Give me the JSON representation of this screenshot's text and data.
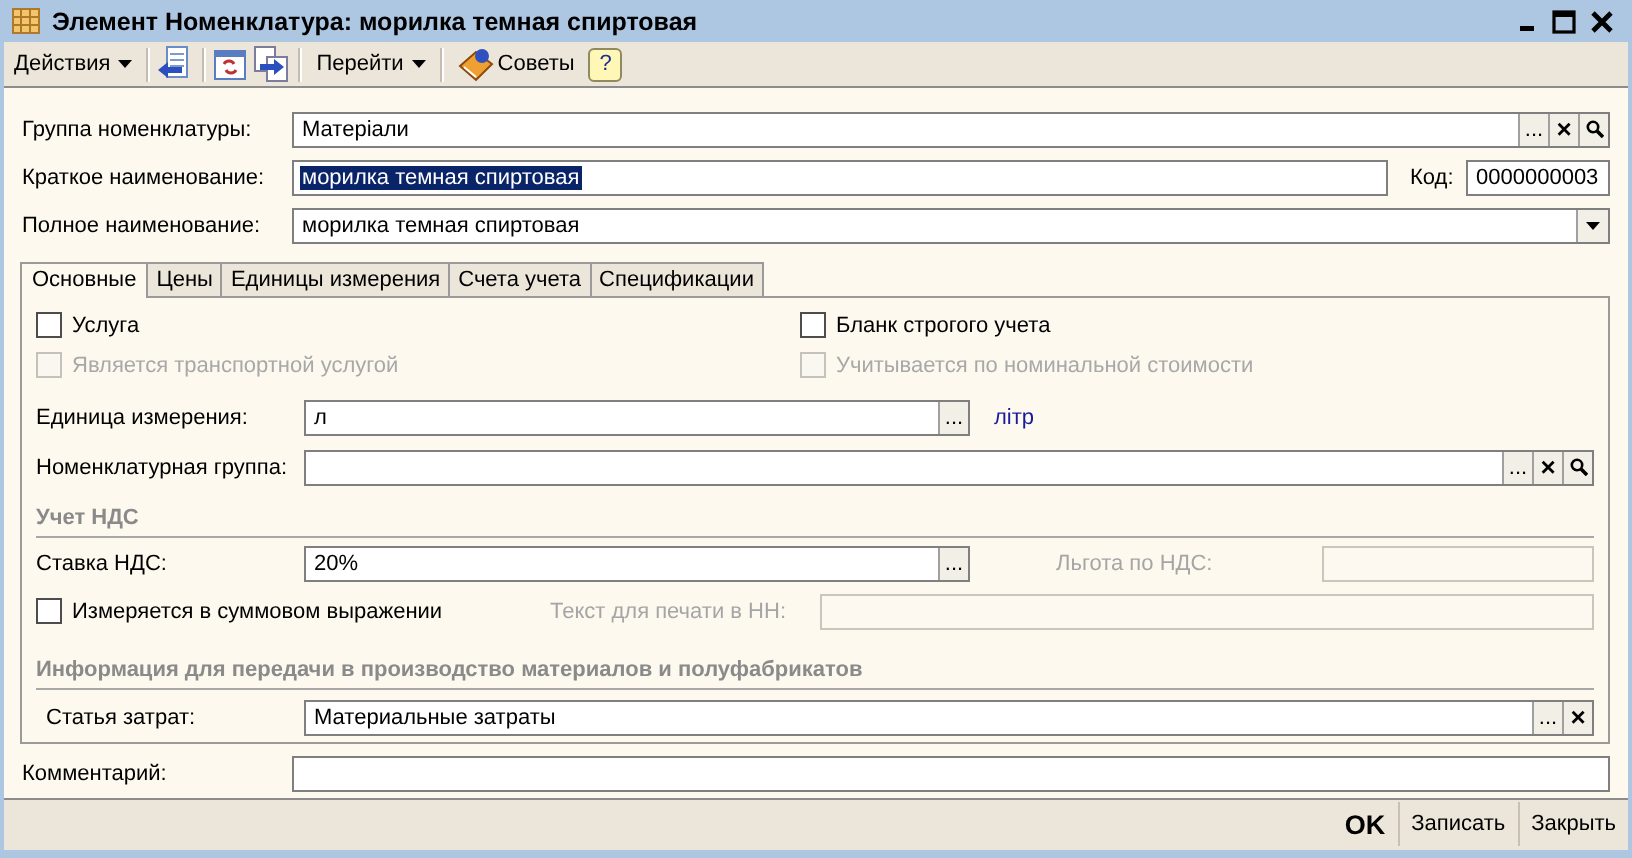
{
  "window": {
    "title": "Элемент Номенклатура: морилка темная спиртовая"
  },
  "toolbar": {
    "actions_menu": "Действия",
    "goto_menu": "Перейти",
    "tips_button": "Советы",
    "help_button": "?"
  },
  "group": {
    "label": "Группа номенклатуры:",
    "value": "Матеріали",
    "buttons": [
      {
        "kind": "select",
        "label": "..."
      },
      {
        "kind": "clear",
        "label": "×"
      },
      {
        "kind": "search"
      }
    ]
  },
  "short_name": {
    "label": "Краткое наименование:",
    "value": "морилка темная спиртовая",
    "selected": true
  },
  "code": {
    "label": "Код:",
    "value": "0000000003"
  },
  "full_name": {
    "label": "Полное наименование:",
    "value": "морилка темная спиртовая",
    "buttons": [
      {
        "kind": "dropdown"
      }
    ]
  },
  "tabs": [
    {
      "label": "Основные",
      "selected": true
    },
    {
      "label": "Цены",
      "selected": false
    },
    {
      "label": "Единицы измерения",
      "selected": false
    },
    {
      "label": "Счета учета",
      "selected": false
    },
    {
      "label": "Спецификации",
      "selected": false
    }
  ],
  "checkboxes": [
    {
      "label": "Услуга",
      "checked": false,
      "disabled": false
    },
    {
      "label": "Бланк строгого учета",
      "checked": false,
      "disabled": false
    },
    {
      "label": "Является транспортной услугой",
      "checked": false,
      "disabled": true
    },
    {
      "label": "Учитывается по номинальной стоимости",
      "checked": false,
      "disabled": true
    }
  ],
  "unit": {
    "label": "Единица измерения:",
    "value": "л",
    "buttons": [
      {
        "kind": "select",
        "label": "..."
      }
    ],
    "link": "літр"
  },
  "item_group": {
    "label": "Номенклатурная группа:",
    "buttons": [
      {
        "kind": "select",
        "label": "..."
      },
      {
        "kind": "clear",
        "label": "×"
      },
      {
        "kind": "search"
      }
    ]
  },
  "vat_section": {
    "title": "Учет НДС"
  },
  "vat_rate": {
    "label": "Ставка НДС:",
    "value": "20%",
    "buttons": [
      {
        "kind": "select",
        "label": "..."
      }
    ]
  },
  "vat_benefit": {
    "label": "Льгота по НДС:",
    "disabled": true
  },
  "sum_checkbox": {
    "label": "Измеряется в суммовом выражении",
    "checked": false,
    "disabled": false
  },
  "print_text": {
    "label": "Текст для печати в НН:",
    "disabled": true
  },
  "production_section": {
    "title": "Информация для передачи в производство материалов и полуфабрикатов"
  },
  "cost_item": {
    "label": "Статья затрат:",
    "value": "Материальные затраты",
    "buttons": [
      {
        "kind": "select",
        "label": "..."
      },
      {
        "kind": "clear",
        "label": "×"
      }
    ]
  },
  "comment": {
    "label": "Комментарий:"
  },
  "footer_buttons": [
    {
      "label": "OK",
      "default": true
    },
    {
      "label": "Записать",
      "default": false
    },
    {
      "label": "Закрыть",
      "default": false
    }
  ]
}
